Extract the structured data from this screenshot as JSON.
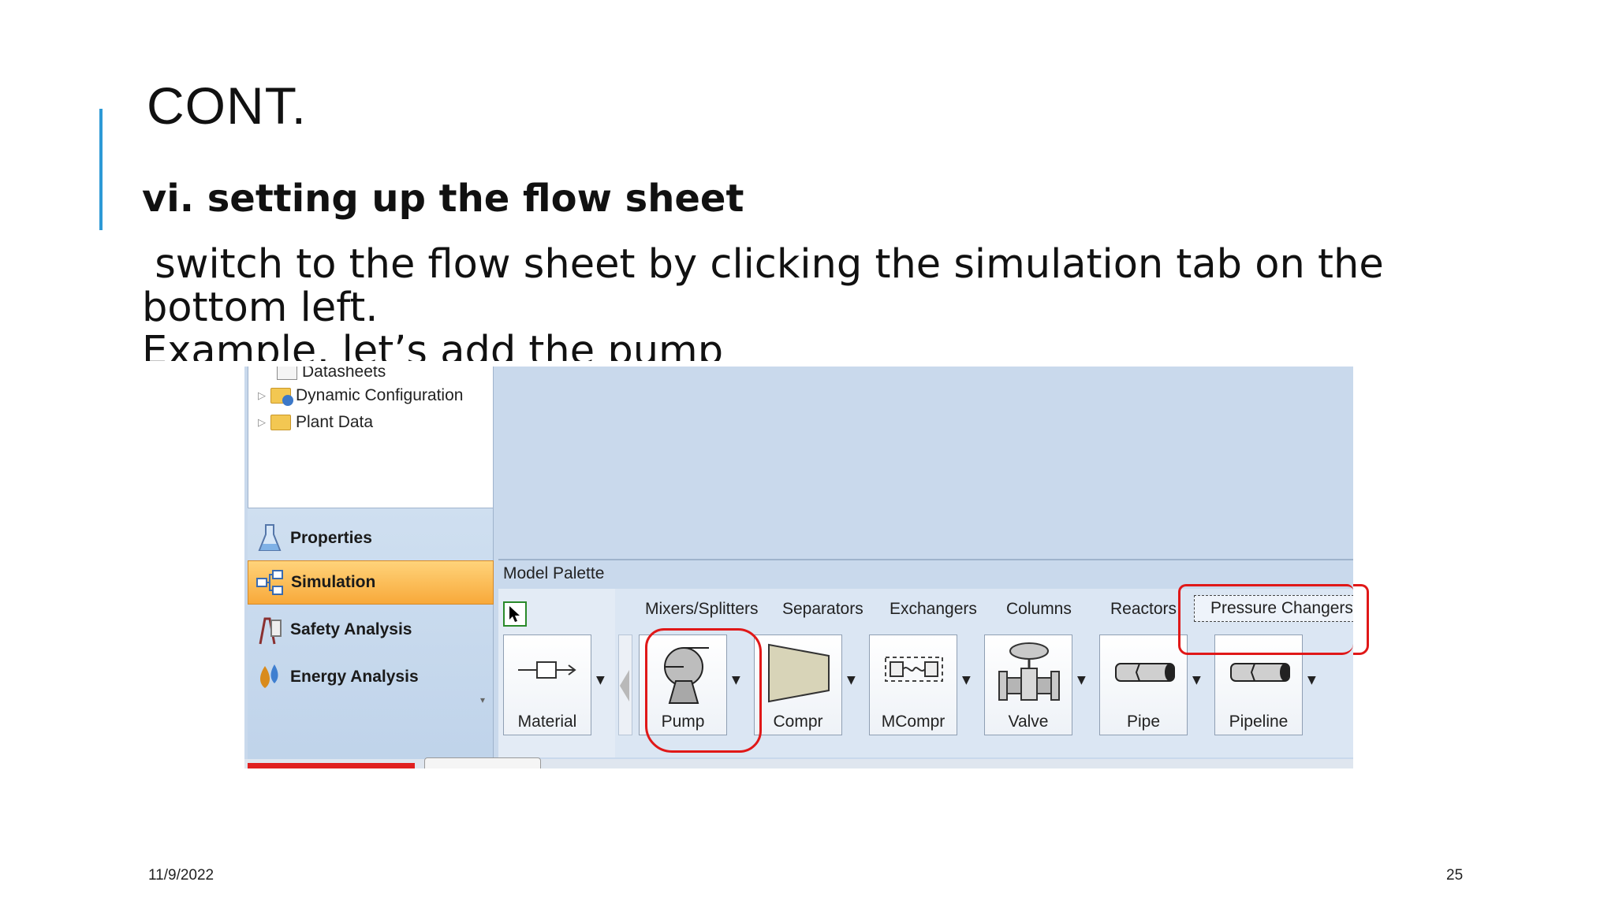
{
  "slide": {
    "title": "CONT.",
    "subheading": "vi. setting up the flow sheet",
    "body_lines": [
      " switch to the flow sheet by clicking the simulation tab on the",
      "bottom left.",
      "Example, let’s add the pump"
    ],
    "date": "11/9/2022",
    "page_number": "25",
    "accent_color": "#2e9ad6"
  },
  "screenshot": {
    "tree": {
      "items": [
        {
          "label": "Datasheets",
          "icon": "datasheet-icon"
        },
        {
          "label": "Dynamic Configuration",
          "icon": "folder-check-icon"
        },
        {
          "label": "Plant Data",
          "icon": "folder-icon"
        }
      ]
    },
    "nav": {
      "buttons": [
        {
          "label": "Properties",
          "icon": "flask-icon",
          "active": false
        },
        {
          "label": "Simulation",
          "icon": "flowsheet-icon",
          "active": true
        },
        {
          "label": "Safety Analysis",
          "icon": "safety-icon",
          "active": false
        },
        {
          "label": "Energy Analysis",
          "icon": "energy-icon",
          "active": false
        }
      ],
      "active_color": "#f8a93a"
    },
    "palette": {
      "title": "Model Palette",
      "tabs": [
        "Mixers/Splitters",
        "Separators",
        "Exchangers",
        "Columns",
        "Reactors",
        "Pressure Changers"
      ],
      "selected_tab": "Pressure Changers",
      "material_label": "Material",
      "models": [
        "Pump",
        "Compr",
        "MCompr",
        "Valve",
        "Pipe",
        "Pipeline"
      ]
    },
    "annotation_color": "#e01818"
  }
}
